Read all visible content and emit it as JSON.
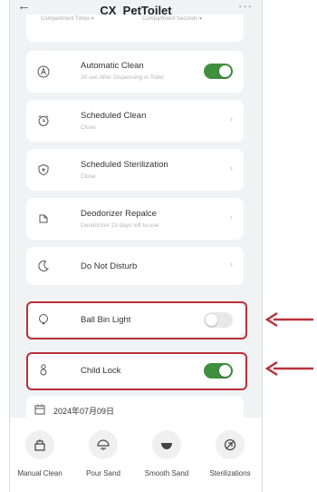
{
  "header": {
    "title": "CX_PetToilet",
    "back_icon": "back-arrow-icon",
    "more_icon": "more-dots-icon"
  },
  "top_sub_row": {
    "left": "Compartment Times ▾",
    "right": "Compartment Seconds ▾"
  },
  "settings": [
    {
      "id": "automatic-clean",
      "label": "Automatic Clean",
      "sublabel": "30 sec After Dispensing in Toilet",
      "control": "toggle",
      "value": true,
      "icon": "auto-clean-icon"
    },
    {
      "id": "scheduled-clean",
      "label": "Scheduled Clean",
      "sublabel": "Close",
      "control": "chevron",
      "icon": "alarm-clock-icon"
    },
    {
      "id": "scheduled-sterilization",
      "label": "Scheduled Sterilization",
      "sublabel": "Close",
      "control": "chevron",
      "icon": "shield-icon"
    },
    {
      "id": "deodorizer-replace",
      "label": "Deodorizer Repalce",
      "sublabel": "Deodorizer 23 days left to use",
      "control": "chevron",
      "icon": "deodorizer-icon"
    },
    {
      "id": "do-not-disturb",
      "label": "Do Not Disturb",
      "control": "chevron",
      "icon": "moon-icon"
    },
    {
      "id": "ball-bin-light",
      "label": "Ball Bin Light",
      "control": "toggle",
      "value": false,
      "icon": "light-icon",
      "highlighted": true
    },
    {
      "id": "child-lock",
      "label": "Child Lock",
      "control": "toggle",
      "value": true,
      "icon": "child-lock-icon",
      "highlighted": true
    }
  ],
  "date_row": {
    "date": "2024年07月09日",
    "icon": "calendar-icon"
  },
  "bottom_actions": [
    {
      "label": "Manual Clean",
      "icon": "manual-clean-icon"
    },
    {
      "label": "Pour Sand",
      "icon": "pour-sand-icon"
    },
    {
      "label": "Smooth Sand",
      "icon": "smooth-sand-icon"
    },
    {
      "label": "Sterilizations",
      "icon": "sterilization-icon"
    }
  ],
  "colors": {
    "toggle_on": "#3f8f3f",
    "highlight": "#b8313b",
    "background": "#f1f2f4"
  }
}
